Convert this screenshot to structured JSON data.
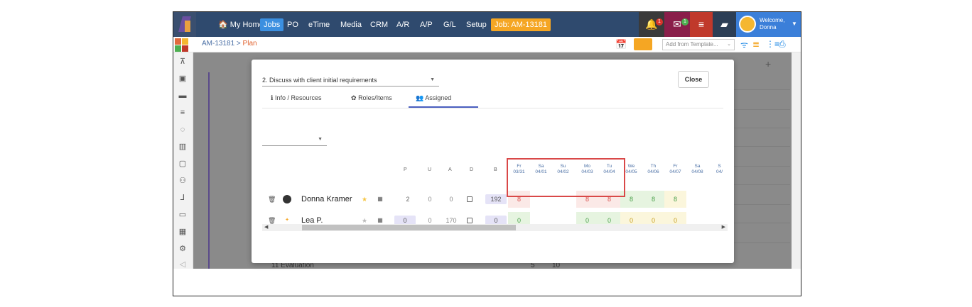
{
  "nav": {
    "items": [
      {
        "label": "🏠 My Home"
      },
      {
        "label": "Jobs"
      },
      {
        "label": "PO"
      },
      {
        "label": "eTime"
      },
      {
        "label": "Media"
      },
      {
        "label": "CRM"
      },
      {
        "label": "A/R"
      },
      {
        "label": "A/P"
      },
      {
        "label": "G/L"
      },
      {
        "label": "Setup"
      }
    ],
    "job_button": "Job: AM-13181",
    "notif_badge": "1",
    "mail_badge": "1",
    "welcome_line1": "Welcome,",
    "welcome_line2": "Donna"
  },
  "breadcrumb": {
    "parent": "AM-13181",
    "sep": " > ",
    "current": "Plan"
  },
  "template_select": "Add from Template...",
  "background": {
    "footer_row": "11   Evaluation",
    "footer_num1": "5",
    "footer_num2": "10"
  },
  "modal": {
    "task_select": "2. Discuss with client initial requirements",
    "close_label": "Close",
    "tabs": [
      {
        "icon": "ℹ",
        "label": "Info / Resources"
      },
      {
        "icon": "✿",
        "label": "Roles/Items"
      },
      {
        "icon": "👥",
        "label": "Assigned"
      }
    ],
    "col_headers": [
      "P",
      "U",
      "A",
      "D",
      "B"
    ],
    "days": [
      {
        "dow": "Fr",
        "date": "03/31"
      },
      {
        "dow": "Sa",
        "date": "04/01"
      },
      {
        "dow": "Su",
        "date": "04/02"
      },
      {
        "dow": "Mo",
        "date": "04/03"
      },
      {
        "dow": "Tu",
        "date": "04/04"
      },
      {
        "dow": "We",
        "date": "04/05"
      },
      {
        "dow": "Th",
        "date": "04/06"
      },
      {
        "dow": "Fr",
        "date": "04/07"
      },
      {
        "dow": "Sa",
        "date": "04/08"
      },
      {
        "dow": "S",
        "date": "04/"
      }
    ],
    "rows": [
      {
        "name": "Donna Kramer",
        "starred": true,
        "p": "2",
        "u": "0",
        "a": "0",
        "b": "192",
        "days": [
          "8",
          "",
          "",
          "8",
          "8",
          "8",
          "8",
          "8",
          "",
          ""
        ]
      },
      {
        "name": "Lea P.",
        "starred": false,
        "p": "0",
        "u": "0",
        "a": "170",
        "b": "0",
        "days": [
          "0",
          "",
          "",
          "0",
          "0",
          "0",
          "0",
          "0",
          "",
          ""
        ]
      }
    ]
  },
  "colors": {
    "nav_bg": "#2f4a6e",
    "accent_orange": "#f5a623",
    "highlight_red": "#d94848",
    "over_cell": "#fbe9e7",
    "ok_cell": "#e6f4e0",
    "warn_cell": "#fbf6dc"
  }
}
